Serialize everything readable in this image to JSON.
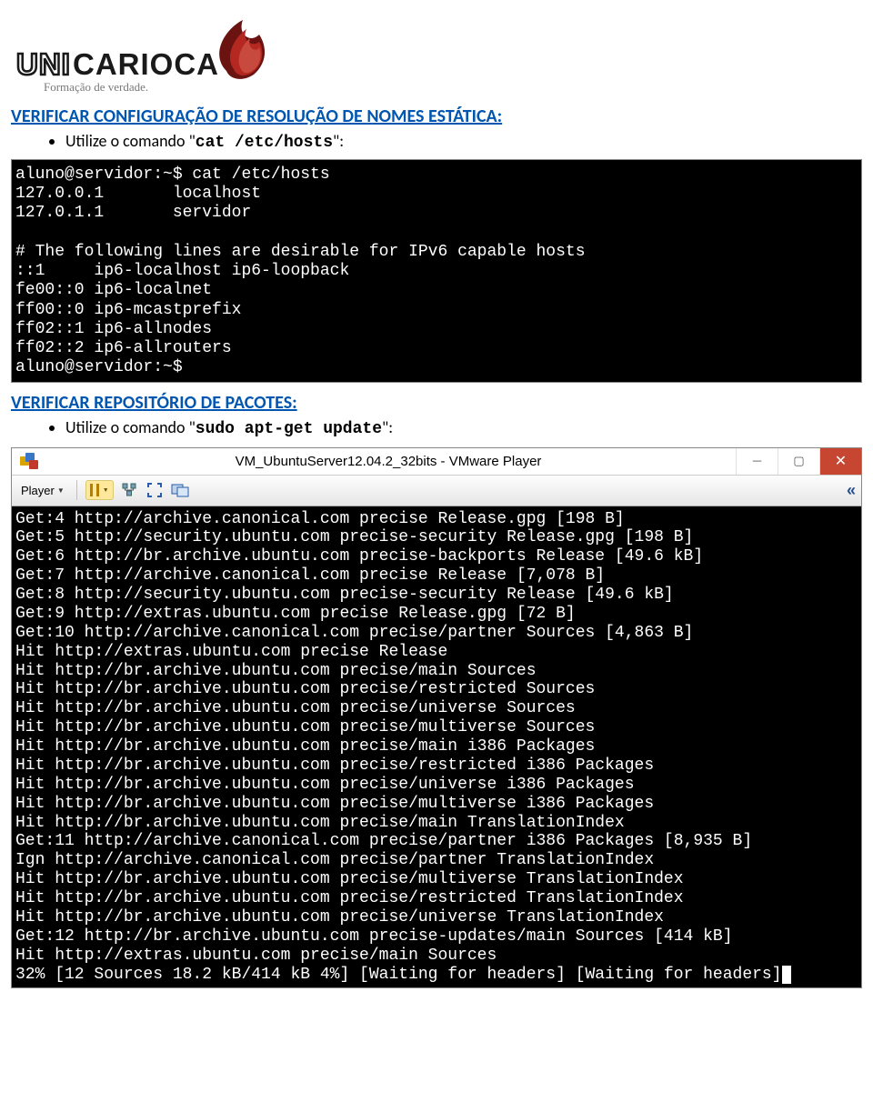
{
  "logo": {
    "brand": "UNICARIOCA",
    "tagline": "Formação de verdade."
  },
  "section1": {
    "heading": "VERIFICAR CONFIGURAÇÃO DE RESOLUÇÃO DE NOMES ESTÁTICA:",
    "bullet_prefix": "Utilize o comando \"",
    "command": "cat /etc/hosts",
    "bullet_suffix": "\":",
    "terminal": "aluno@servidor:~$ cat /etc/hosts\n127.0.0.1       localhost\n127.0.1.1       servidor\n\n# The following lines are desirable for IPv6 capable hosts\n::1     ip6-localhost ip6-loopback\nfe00::0 ip6-localnet\nff00::0 ip6-mcastprefix\nff02::1 ip6-allnodes\nff02::2 ip6-allrouters\naluno@servidor:~$ "
  },
  "section2": {
    "heading": "VERIFICAR REPOSITÓRIO DE PACOTES:",
    "bullet_prefix": "Utilize o comando \"",
    "command": "sudo apt-get update",
    "bullet_suffix": "\":",
    "vm": {
      "title": "VM_UbuntuServer12.04.2_32bits - VMware Player",
      "player_label": "Player",
      "terminal": "Get:4 http://archive.canonical.com precise Release.gpg [198 B]\nGet:5 http://security.ubuntu.com precise-security Release.gpg [198 B]\nGet:6 http://br.archive.ubuntu.com precise-backports Release [49.6 kB]\nGet:7 http://archive.canonical.com precise Release [7,078 B]\nGet:8 http://security.ubuntu.com precise-security Release [49.6 kB]\nGet:9 http://extras.ubuntu.com precise Release.gpg [72 B]\nGet:10 http://archive.canonical.com precise/partner Sources [4,863 B]\nHit http://extras.ubuntu.com precise Release\nHit http://br.archive.ubuntu.com precise/main Sources\nHit http://br.archive.ubuntu.com precise/restricted Sources\nHit http://br.archive.ubuntu.com precise/universe Sources\nHit http://br.archive.ubuntu.com precise/multiverse Sources\nHit http://br.archive.ubuntu.com precise/main i386 Packages\nHit http://br.archive.ubuntu.com precise/restricted i386 Packages\nHit http://br.archive.ubuntu.com precise/universe i386 Packages\nHit http://br.archive.ubuntu.com precise/multiverse i386 Packages\nHit http://br.archive.ubuntu.com precise/main TranslationIndex\nGet:11 http://archive.canonical.com precise/partner i386 Packages [8,935 B]\nIgn http://archive.canonical.com precise/partner TranslationIndex\nHit http://br.archive.ubuntu.com precise/multiverse TranslationIndex\nHit http://br.archive.ubuntu.com precise/restricted TranslationIndex\nHit http://br.archive.ubuntu.com precise/universe TranslationIndex\nGet:12 http://br.archive.ubuntu.com precise-updates/main Sources [414 kB]\nHit http://extras.ubuntu.com precise/main Sources\n32% [12 Sources 18.2 kB/414 kB 4%] [Waiting for headers] [Waiting for headers]"
    }
  }
}
